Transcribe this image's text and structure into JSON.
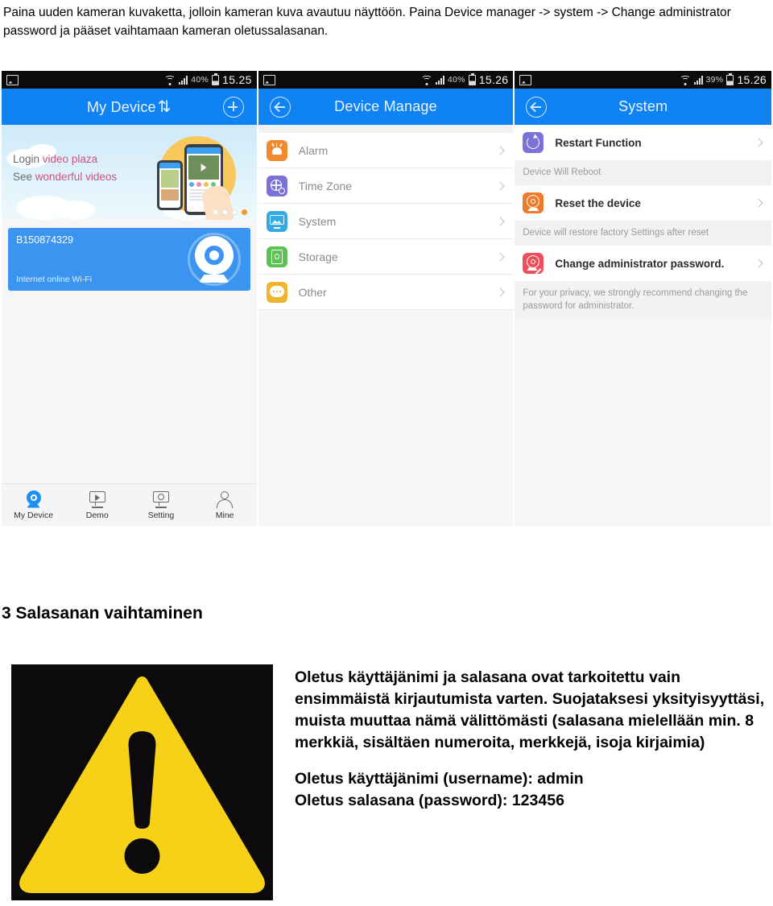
{
  "intro": {
    "paragraph": "Paina uuden kameran kuvaketta, jolloin kameran kuva avautuu näyttöön. Paina Device manager -> system -> Change administrator password ja pääset vaihtamaan kameran oletussalasanan."
  },
  "phone1": {
    "statusbar": {
      "wifi_percent": "40%",
      "time": "15.25"
    },
    "appbar": {
      "title": "My Device",
      "wave_glyph": "⇅",
      "add_button": "+"
    },
    "banner": {
      "line1_plain": "Login ",
      "line1_highlight": "video plaza",
      "line2_plain": "See ",
      "line2_highlight": "wonderful videos",
      "pager_dots": 4,
      "pager_active_index": 3
    },
    "device_card": {
      "serial": "B150874329",
      "status": "Internet online Wi-Fi"
    },
    "bottom_nav": [
      {
        "label": "My Device",
        "icon": "camera-icon",
        "active": true
      },
      {
        "label": "Demo",
        "icon": "monitor-play-icon",
        "active": false
      },
      {
        "label": "Setting",
        "icon": "monitor-gear-icon",
        "active": false
      },
      {
        "label": "Mine",
        "icon": "person-icon",
        "active": false
      }
    ]
  },
  "phone2": {
    "statusbar": {
      "wifi_percent": "40%",
      "time": "15.26"
    },
    "appbar": {
      "title": "Device Manage",
      "back_button": "back-arrow-icon"
    },
    "rows": [
      {
        "label": "Alarm",
        "icon": "alarm-icon"
      },
      {
        "label": "Time Zone",
        "icon": "globe-clock-icon"
      },
      {
        "label": "System",
        "icon": "monitor-icon"
      },
      {
        "label": "Storage",
        "icon": "sd-card-icon"
      },
      {
        "label": "Other",
        "icon": "chat-bubble-icon"
      }
    ]
  },
  "phone3": {
    "statusbar": {
      "wifi_percent": "39%",
      "time": "15.26"
    },
    "appbar": {
      "title": "System",
      "back_button": "back-arrow-icon"
    },
    "rows": [
      {
        "label": "Restart Function",
        "icon": "restart-icon",
        "note": "Device Will Reboot"
      },
      {
        "label": "Reset the device",
        "icon": "reset-camera-icon",
        "note": "Device will restore factory Settings after reset"
      },
      {
        "label": "Change administrator password.",
        "icon": "camera-pencil-icon",
        "note": "For your privacy, we strongly recommend changing the password for administrator."
      }
    ]
  },
  "section3": {
    "title": "3 Salasanan vaihtaminen",
    "warning_icon": "warning-triangle-icon",
    "body": "Oletus käyttäjänimi ja salasana ovat tarkoitettu vain ensimmäistä kirjautumista varten. Suojataksesi yksityisyyttäsi, muista muuttaa nämä välittömästi (salasana mielellään min. 8 merkkiä, sisältäen numeroita, merkkejä, isoja kirjaimia)",
    "default_username_line": "Oletus käyttäjänimi (username): admin",
    "default_password_line": "Oletus salasana (password): 123456"
  },
  "colors": {
    "appbar_blue": "#0f82f4",
    "card_blue": "#3b94ef",
    "warning_yellow": "#f7d117",
    "warning_bg": "#0c0a0d"
  }
}
